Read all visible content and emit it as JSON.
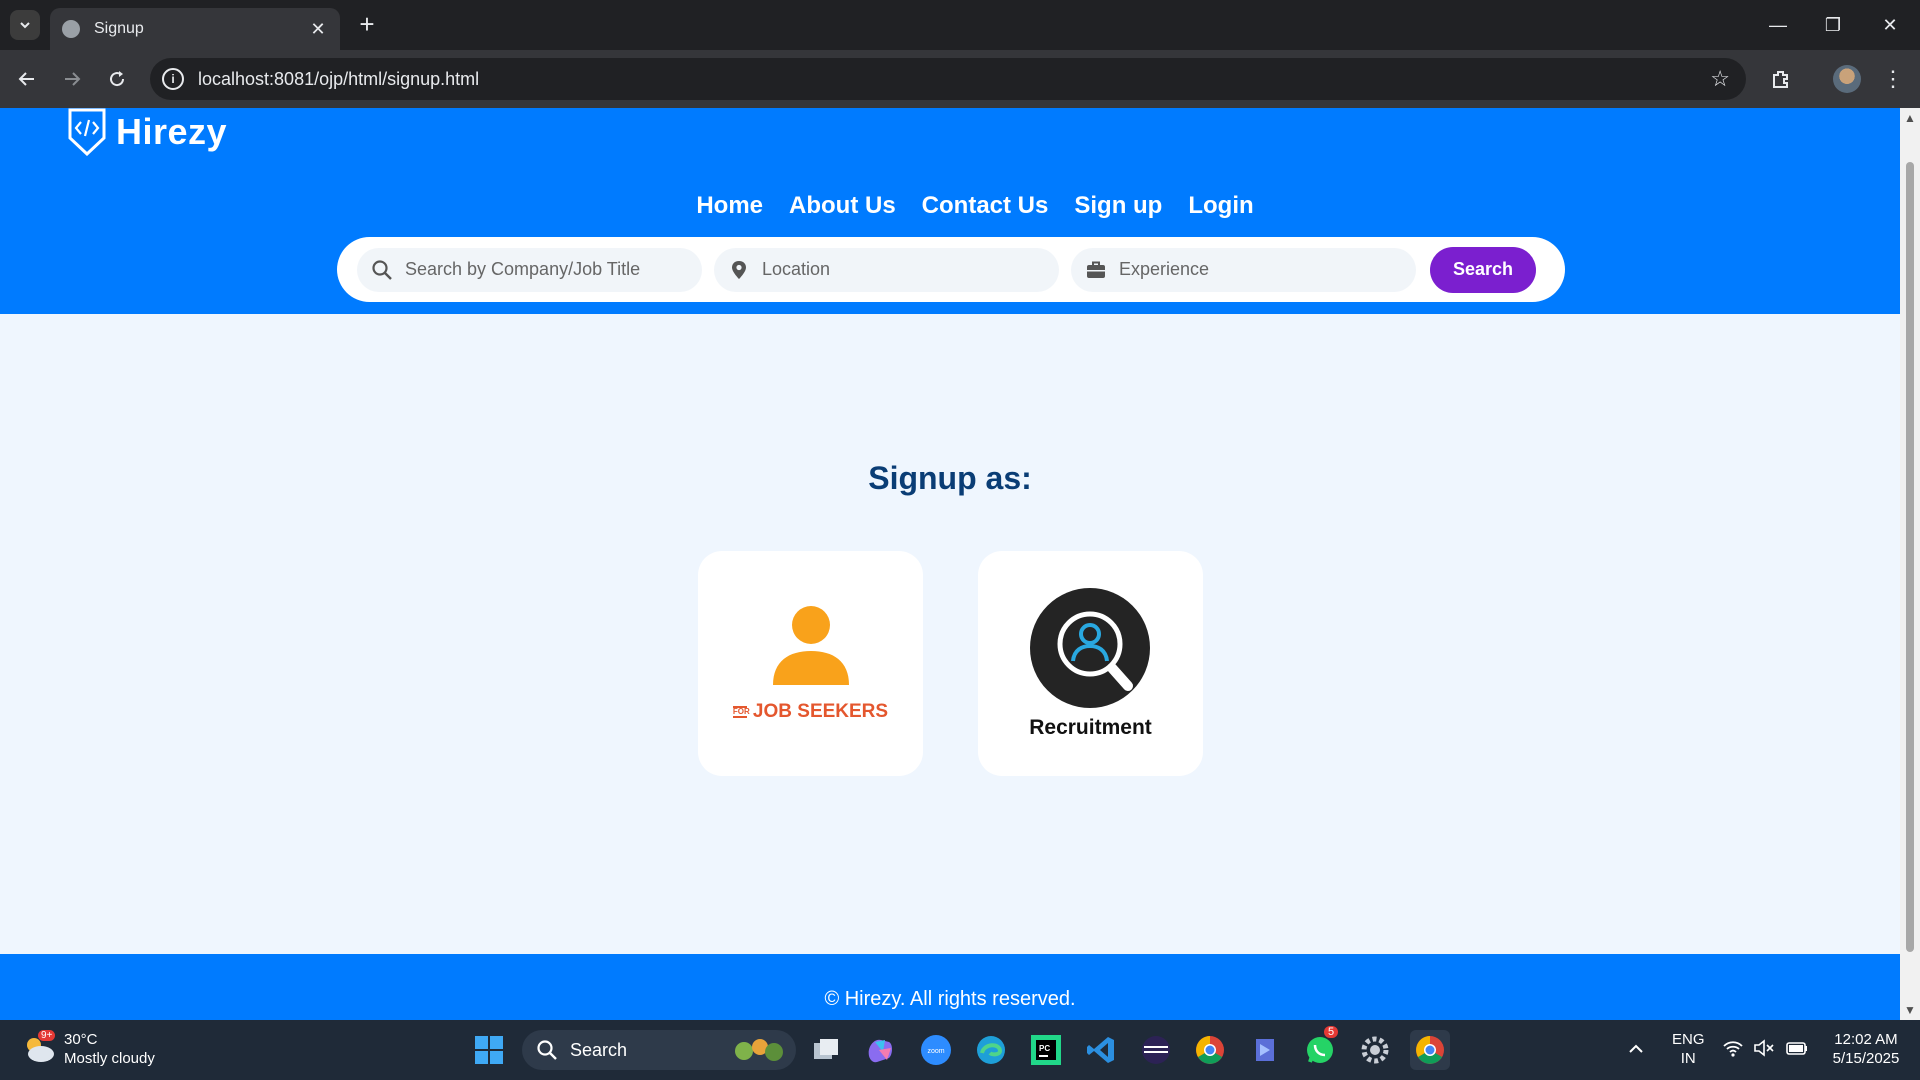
{
  "browser": {
    "tab_title": "Signup",
    "url": "localhost:8081/ojp/html/signup.html",
    "window_controls": {
      "minimize": "—",
      "restore": "❐",
      "close": "✕"
    }
  },
  "site": {
    "brand": "Hirezy",
    "nav": [
      "Home",
      "About Us",
      "Contact Us",
      "Sign up",
      "Login"
    ],
    "search": {
      "company_placeholder": "Search by Company/Job Title",
      "location_placeholder": "Location",
      "experience_placeholder": "Experience",
      "button": "Search"
    },
    "colors": {
      "primary": "#007bff",
      "heading": "#0a3d75",
      "accent_button": "#7b1fcf",
      "orange": "#f9a21b"
    },
    "heading": "Signup as:",
    "options": [
      {
        "label": "JOB SEEKERS",
        "small_label": "FOR"
      },
      {
        "label": "Recruitment"
      }
    ],
    "footer": "© Hirezy. All rights reserved."
  },
  "taskbar": {
    "weather": {
      "temp": "30°C",
      "condition": "Mostly cloudy",
      "badge": "9+"
    },
    "search_label": "Search",
    "whatsapp_badge": "5",
    "lang": {
      "line1": "ENG",
      "line2": "IN"
    },
    "clock": {
      "time": "12:02 AM",
      "date": "5/15/2025"
    }
  }
}
